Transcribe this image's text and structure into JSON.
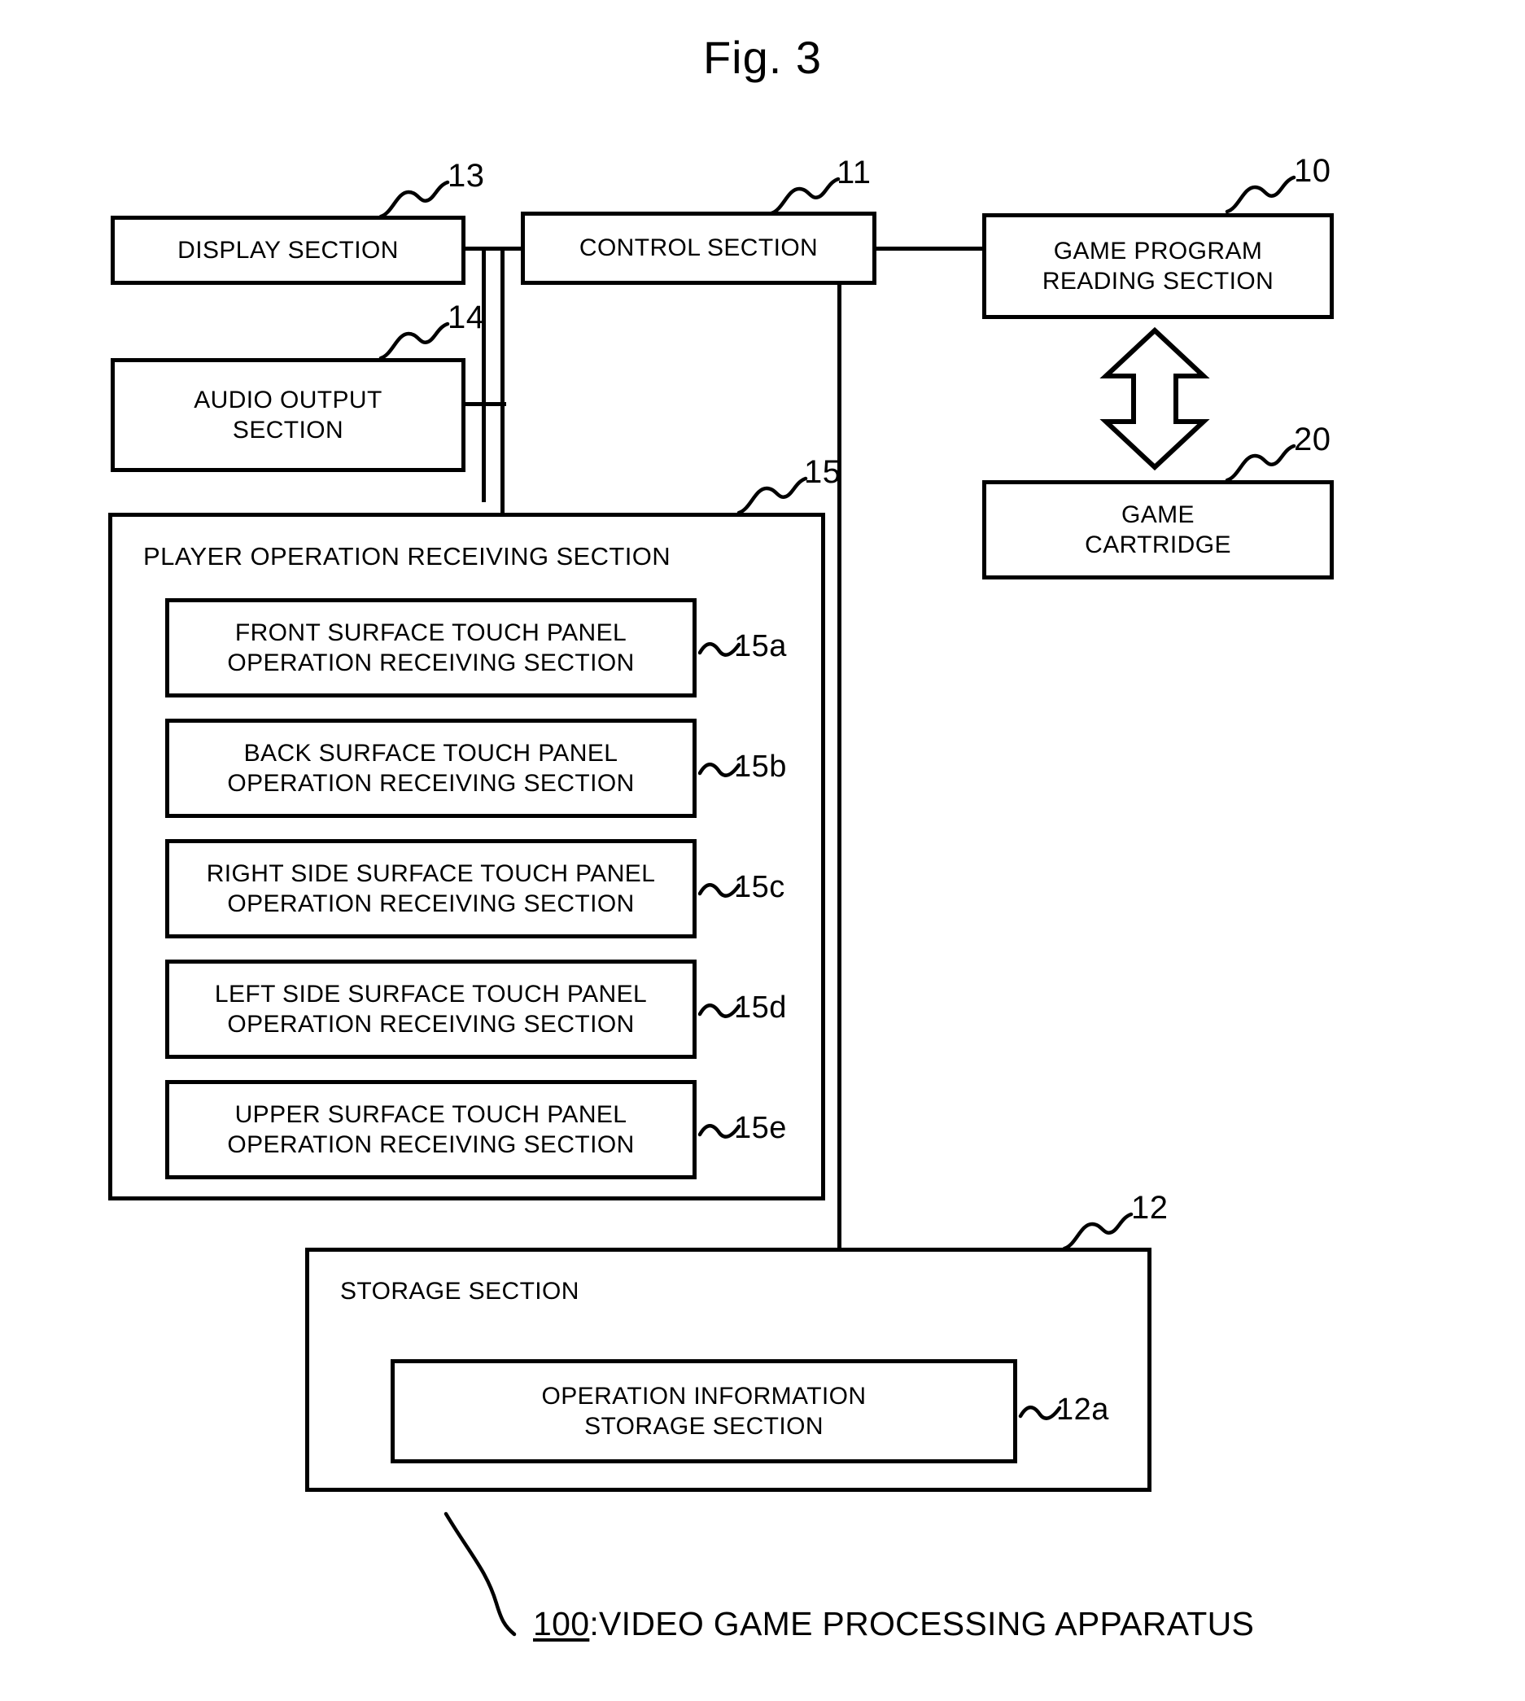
{
  "figure": {
    "title": "Fig. 3",
    "caption_number": "100",
    "caption_separator": ":",
    "caption_text": "VIDEO GAME PROCESSING APPARATUS"
  },
  "blocks": {
    "display_section": {
      "label": "DISPLAY SECTION",
      "ref": "13"
    },
    "control_section": {
      "label": "CONTROL SECTION",
      "ref": "11"
    },
    "game_program_reading_section": {
      "label": "GAME PROGRAM\nREADING SECTION",
      "ref": "10"
    },
    "game_cartridge": {
      "label": "GAME\nCARTRIDGE",
      "ref": "20"
    },
    "audio_output_section": {
      "label": "AUDIO OUTPUT\nSECTION",
      "ref": "14"
    },
    "player_operation_receiving_section": {
      "label": "PLAYER OPERATION RECEIVING SECTION",
      "ref": "15"
    },
    "storage_section": {
      "label": "STORAGE SECTION",
      "ref": "12"
    },
    "operation_information_storage_section": {
      "label": "OPERATION INFORMATION\nSTORAGE SECTION",
      "ref": "12a"
    }
  },
  "touch_panel_sections": [
    {
      "label": "FRONT SURFACE TOUCH PANEL\nOPERATION RECEIVING SECTION",
      "ref": "15a"
    },
    {
      "label": "BACK SURFACE TOUCH PANEL\nOPERATION RECEIVING SECTION",
      "ref": "15b"
    },
    {
      "label": "RIGHT SIDE SURFACE TOUCH PANEL\nOPERATION RECEIVING SECTION",
      "ref": "15c"
    },
    {
      "label": "LEFT SIDE SURFACE TOUCH PANEL\nOPERATION RECEIVING SECTION",
      "ref": "15d"
    },
    {
      "label": "UPPER SURFACE TOUCH PANEL\nOPERATION RECEIVING SECTION",
      "ref": "15e"
    }
  ],
  "colors": {
    "stroke": "#000000",
    "background": "#ffffff"
  }
}
